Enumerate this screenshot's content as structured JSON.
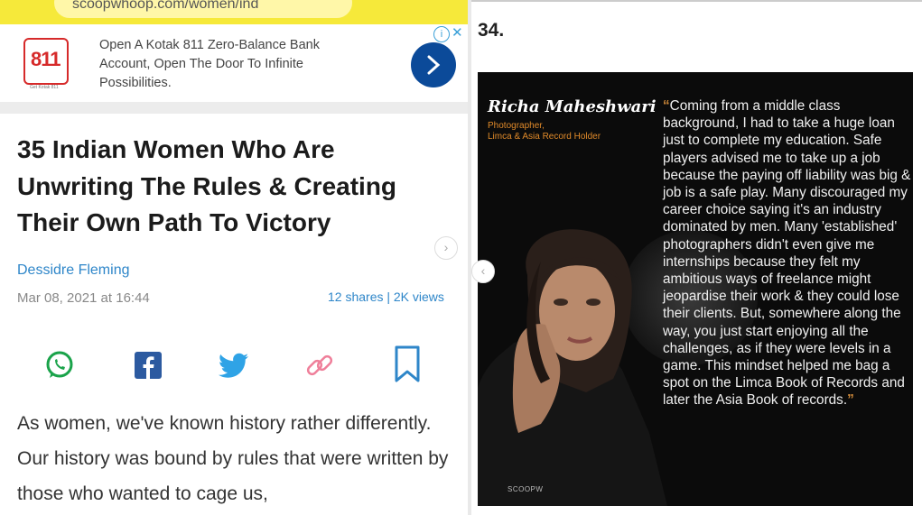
{
  "browser": {
    "url": "scoopwhoop.com/women/ind"
  },
  "ad": {
    "logo_text": "811",
    "logo_subtext": "Get Kotak 811",
    "text": "Open A Kotak 811 Zero-Balance Bank Account, Open The Door To Infinite Possibilities.",
    "info_icon": "i",
    "close_icon": "✕"
  },
  "article": {
    "title": "35 Indian Women Who Are Unwriting The Rules & Creating Their Own Path To Victory",
    "author": "Dessidre Fleming",
    "date": "Mar 08, 2021 at 16:44",
    "stats": "12 shares | 2K views",
    "share_icons": [
      "whatsapp-icon",
      "facebook-icon",
      "twitter-icon",
      "link-icon",
      "bookmark-icon"
    ],
    "body": "As women, we've known history rather differently. Our history was bound by rules that were written by those who wanted to cage us,"
  },
  "carousel": {
    "next_icon": "›",
    "prev_icon": "‹"
  },
  "slide": {
    "number": "34.",
    "name": "Richa Maheshwari",
    "role_line1": "Photographer,",
    "role_line2": "Limca & Asia Record Holder",
    "quote_open": "“",
    "quote": "Coming from a middle class background, I had to take a huge loan just to complete my education. Safe players advised me to take up a job because the paying off liability was big & job is a safe play. Many discouraged my career choice saying it's an industry dominated by men. Many 'established' photographers didn't even give me internships because they felt my ambitious ways of freelance might jeopardise their work & they could lose their clients. But, somewhere along the way, you just start enjoying all the challenges, as if they were levels in a game. This mindset helped me bag a spot on the Limca Book of Records and later the Asia Book of records.",
    "quote_close": "”",
    "watermark": "SCOOPW"
  },
  "colors": {
    "urlbar": "#f6e93a",
    "link": "#2e86c9",
    "accent_orange": "#e08a2a",
    "ad_button": "#0b4a99"
  }
}
